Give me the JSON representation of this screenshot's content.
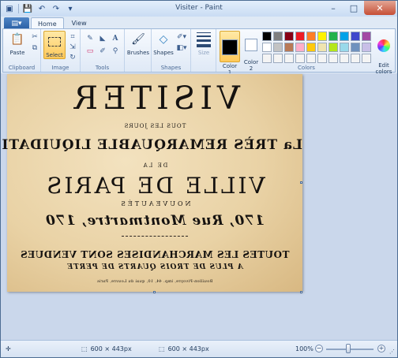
{
  "window": {
    "title": "Visiter - Paint",
    "min_glyph": "–",
    "max_glyph": "□",
    "close_glyph": "✕"
  },
  "quick_access": {
    "app_glyph": "▣",
    "save_glyph": "💾",
    "undo_glyph": "↶",
    "redo_glyph": "↷",
    "more_glyph": "▾"
  },
  "tabs": {
    "file_glyph": "▤▾",
    "home": "Home",
    "view": "View"
  },
  "ribbon": {
    "clipboard": {
      "label": "Clipboard",
      "paste": "Paste",
      "paste_glyph": "📋",
      "cut_glyph": "✂",
      "copy_glyph": "⧉"
    },
    "image": {
      "label": "Image",
      "select": "Select",
      "crop_glyph": "⌗",
      "resize_glyph": "⇲",
      "rotate_glyph": "↻"
    },
    "tools": {
      "label": "Tools",
      "pencil_glyph": "✎",
      "fill_glyph": "◣",
      "text_glyph": "A",
      "eraser_glyph": "▭",
      "picker_glyph": "✐",
      "magnifier_glyph": "⚲"
    },
    "brushes": {
      "label": "Brushes",
      "glyph": "🖌"
    },
    "shapes": {
      "label": "Shapes",
      "button": "Shapes",
      "glyph": "◇"
    },
    "outline_glyph": "✐▾",
    "fill_shape_glyph": "◧▾",
    "size": {
      "label": "Size"
    },
    "colors": {
      "label": "Colors",
      "color1_label": "Color\n1",
      "color2_label": "Color\n2",
      "color1": "#000000",
      "color2": "#ffffff",
      "edit": "Edit\ncolors",
      "palette": [
        "#000000",
        "#7f7f7f",
        "#880015",
        "#ed1c24",
        "#ff7f27",
        "#fff200",
        "#22b14c",
        "#00a2e8",
        "#3f48cc",
        "#a349a4",
        "#ffffff",
        "#c3c3c3",
        "#b97a57",
        "#ffaec9",
        "#ffc90e",
        "#efe4b0",
        "#b5e61d",
        "#99d9ea",
        "#7092be",
        "#c8bfe7",
        "#f4f4f4",
        "#f4f4f4",
        "#f4f4f4",
        "#f4f4f4",
        "#f4f4f4",
        "#f4f4f4",
        "#f4f4f4",
        "#f4f4f4",
        "#f4f4f4",
        "#f4f4f4"
      ]
    }
  },
  "poster": {
    "line1": "VISITER",
    "line2": "TOUS LES JOURS",
    "line3": "La TRÈS REMARQUABLE LIQUIDATION",
    "line4": "DE LA",
    "line5": "VILLE DE PARIS",
    "line6": "NOUVEAUTÉS",
    "line7": "170, Rue Montmartre, 170",
    "line8": "TOUTES LES MARCHANDISES SONT VENDUES",
    "line9": "A PLUS DE TROIS QUARTS DE PERTE",
    "line10": "Bouillon-Pivoyre, imp. 44, 10, quai du Louvre, Paris"
  },
  "status": {
    "add_glyph": "✛",
    "cursor_glyph": "⬚",
    "selection_size": "600 × 443px",
    "selection_glyph": "⬚",
    "image_size": "600 × 443px",
    "zoom": "100%",
    "zoom_out_glyph": "−",
    "zoom_in_glyph": "+",
    "resize_glyph": "⋰"
  }
}
